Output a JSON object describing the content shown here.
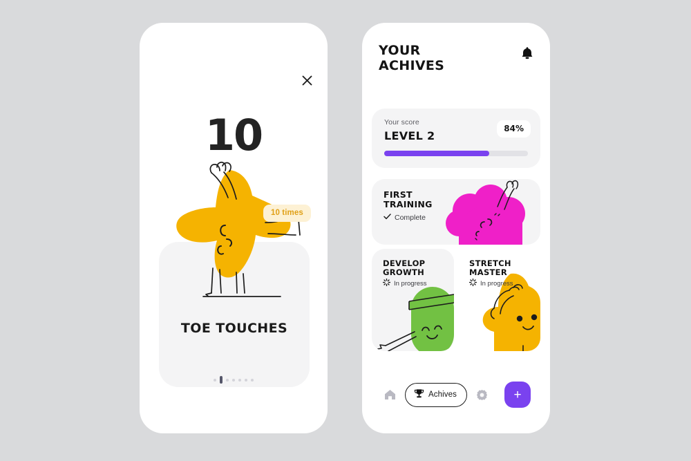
{
  "canvas": {
    "background_color": "#d9dadc"
  },
  "theme": {
    "purple": "#7a42ef",
    "yellow": "#f5b301",
    "magenta": "#ef20c8",
    "green": "#72c143",
    "dark": "#141414",
    "card_gray": "#f4f4f5",
    "badge_cream": "#fdf1d4",
    "badge_amber": "#e0a018"
  },
  "left_screen": {
    "close_icon": "close-icon",
    "count": "10",
    "times_badge": "10 times",
    "exercise_title": "TOE\nTOUCHES",
    "character": "yellow-star-character",
    "pagination": {
      "total": 7,
      "active_index": 1
    }
  },
  "right_screen": {
    "header": {
      "title": "YOUR\nACHIVES",
      "bell_icon": "bell-icon"
    },
    "score": {
      "label": "Your score",
      "level": "LEVEL 2",
      "percent_badge": "84%",
      "progress_percent": 73
    },
    "achievements": [
      {
        "id": "first-training",
        "title": "FIRST\nTRAINING",
        "status": "Complete",
        "status_icon": "check-icon",
        "character": "magenta-flower-character"
      },
      {
        "id": "develop-growth",
        "title": "DEVELOP\nGROWTH",
        "status": "In progress",
        "status_icon": "spinner-icon",
        "character": "green-ninja-character"
      },
      {
        "id": "stretch-master",
        "title": "STRETCH\nMASTER",
        "status": "In progress",
        "status_icon": "spinner-icon",
        "character": "yellow-star-character"
      }
    ],
    "navbar": {
      "home_icon": "home-icon",
      "achives_label": "Achives",
      "achives_icon": "trophy-icon",
      "settings_icon": "gear-icon",
      "add_label": "+"
    }
  }
}
